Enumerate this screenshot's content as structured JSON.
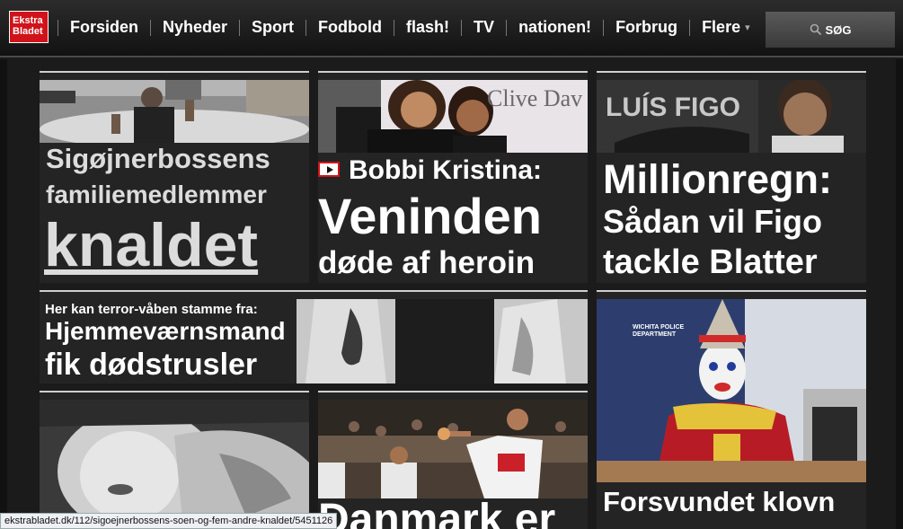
{
  "brand": {
    "logo_line1": "Ekstra",
    "logo_line2": "Bladet"
  },
  "nav": {
    "items": [
      "Forsiden",
      "Nyheder",
      "Sport",
      "Fodbold",
      "flash!",
      "TV",
      "nationen!",
      "Forbrug",
      "Flere"
    ],
    "more_arrow": "▾",
    "search_label": "SØG"
  },
  "articles": {
    "a1": {
      "line1": "Sigøjnerbossens",
      "line2": "familiemedlemmer",
      "line3": "knaldet"
    },
    "a2": {
      "kicker": "Bobbi Kristina:",
      "line1": "Veninden",
      "line2": "døde af heroin",
      "photo_sign": "Clive Dav"
    },
    "a3": {
      "line1": "Millionregn:",
      "line2": "Sådan vil Figo",
      "line3": "tackle Blatter",
      "photo_sign": "LUÍS FIGO"
    },
    "a4": {
      "kicker": "Her kan terror-våben stamme fra:",
      "line1": "Hjemmeværnsmand",
      "line2": "fik dødstrusler"
    },
    "a5": {
      "line1": "Forsvundet klovn",
      "photo_sign": "WICHITA POLICE DEPARTMENT"
    },
    "a6": {
      "line1": "Danmark er"
    }
  },
  "statusbar": {
    "url": "ekstrabladet.dk/112/sigoejnerbossens-soen-og-fem-andre-knaldet/5451126"
  }
}
